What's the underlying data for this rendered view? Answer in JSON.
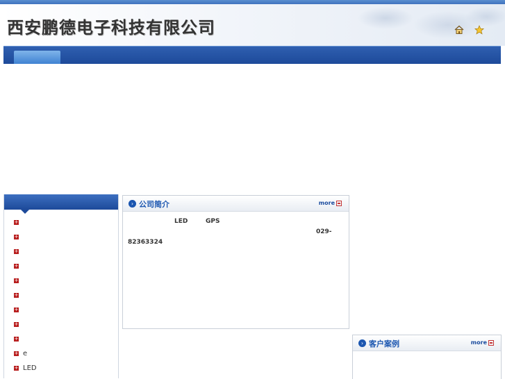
{
  "header": {
    "company_name": "西安鹏德电子科技有限公司",
    "icons": [
      "home-icon",
      "favorite-star-icon"
    ],
    "colors": {
      "brand_blue": "#1d4a9a",
      "accent_red": "#b81e1e"
    }
  },
  "nav": {
    "tabs": [
      {
        "label": ""
      }
    ]
  },
  "sidebar": {
    "title": "",
    "items": [
      {
        "label": ""
      },
      {
        "label": ""
      },
      {
        "label": ""
      },
      {
        "label": ""
      },
      {
        "label": ""
      },
      {
        "label": ""
      },
      {
        "label": ""
      },
      {
        "label": ""
      },
      {
        "label": ""
      },
      {
        "label": "e"
      },
      {
        "label": "LED"
      }
    ]
  },
  "company_intro": {
    "title": "公司简介",
    "more_label": "more",
    "text_led": "LED",
    "text_gps": "GPS",
    "phone_prefix": "029-",
    "phone_number": "82363324"
  },
  "customer_cases": {
    "title": "客户案例",
    "more_label": "more"
  }
}
